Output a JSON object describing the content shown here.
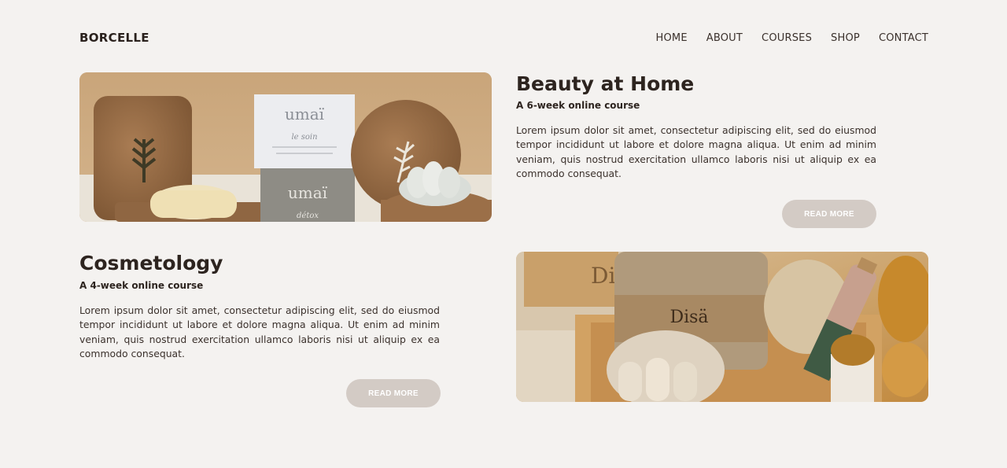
{
  "brand": "BORCELLE",
  "nav": [
    "HOME",
    "ABOUT",
    "COURSES",
    "SHOP",
    "CONTACT"
  ],
  "courses": [
    {
      "title": "Beauty at Home",
      "subtitle": "A 6-week online course",
      "body": "Lorem ipsum dolor sit amet, consectetur adipiscing elit, sed do eiusmod tempor incididunt ut labore et dolore magna aliqua. Ut enim ad minim veniam, quis nostrud exercitation ullamco laboris nisi ut aliquip ex ea commodo consequat.",
      "button": "READ MORE",
      "image_text": {
        "box1_brand": "umaï",
        "box1_line": "le soin",
        "box2_brand": "umaï",
        "box2_line": "détox"
      }
    },
    {
      "title": "Cosmetology",
      "subtitle": "A 4-week online course",
      "body": "Lorem ipsum dolor sit amet, consectetur adipiscing elit, sed do eiusmod tempor incididunt ut labore et dolore magna aliqua. Ut enim ad minim veniam, quis nostrud exercitation ullamco laboris nisi ut aliquip ex ea commodo consequat.",
      "button": "READ MORE",
      "image_text": {
        "pouch_brand": "Disä"
      }
    }
  ],
  "colors": {
    "background": "#f4f2f0",
    "button": "#d3cbc5",
    "text": "#2d241f"
  }
}
